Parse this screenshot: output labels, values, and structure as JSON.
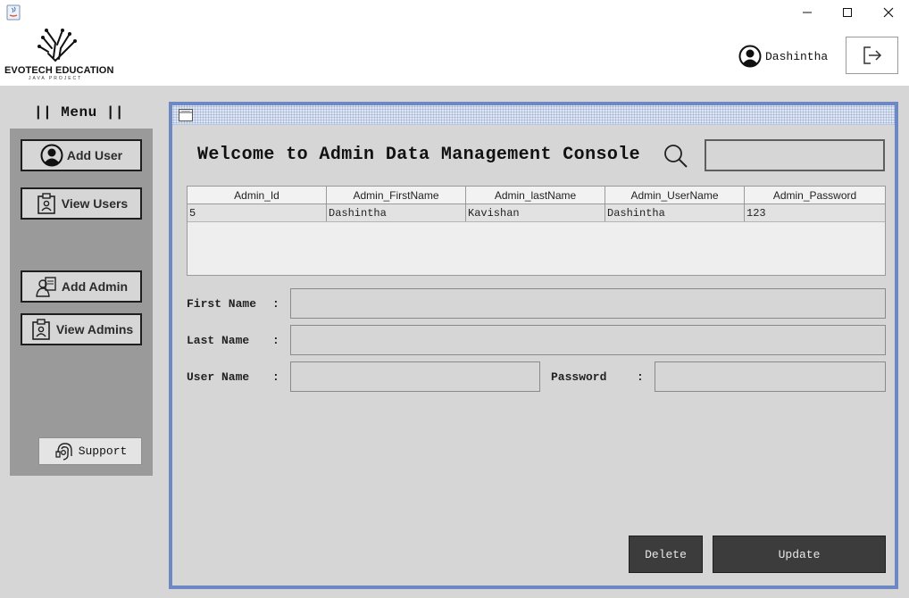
{
  "brand": {
    "name": "EVOTECH EDUCATION",
    "tagline": "JAVA PROJECT"
  },
  "header": {
    "user_name": "Dashintha",
    "logout_icon": "logout-icon"
  },
  "menu": {
    "title": "|| Menu ||",
    "items": [
      {
        "label": "Add User",
        "icon": "user-circle-icon"
      },
      {
        "label": "View Users",
        "icon": "id-card-icon"
      },
      {
        "label": "Add Admin",
        "icon": "admin-icon"
      },
      {
        "label": "View Admins",
        "icon": "id-card-icon"
      }
    ],
    "support_label": "Support"
  },
  "console": {
    "title": "Welcome to Admin Data Management Console",
    "search_value": ""
  },
  "table": {
    "columns": [
      "Admin_Id",
      "Admin_FirstName",
      "Admin_lastName",
      "Admin_UserName",
      "Admin_Password"
    ],
    "rows": [
      [
        "5",
        "Dashintha",
        "Kavishan",
        "Dashintha",
        "123"
      ]
    ]
  },
  "form": {
    "first_name_label": "First Name",
    "last_name_label": "Last Name",
    "user_name_label": "User Name",
    "password_label": "Password",
    "colon": ":",
    "first_name_value": "",
    "last_name_value": "",
    "user_name_value": "",
    "password_value": ""
  },
  "actions": {
    "delete_label": "Delete",
    "update_label": "Update"
  },
  "colors": {
    "frame_border": "#6e88c4",
    "sidebar": "#9a9a9a",
    "background": "#d6d6d6",
    "dark_button": "#3c3c3c"
  }
}
